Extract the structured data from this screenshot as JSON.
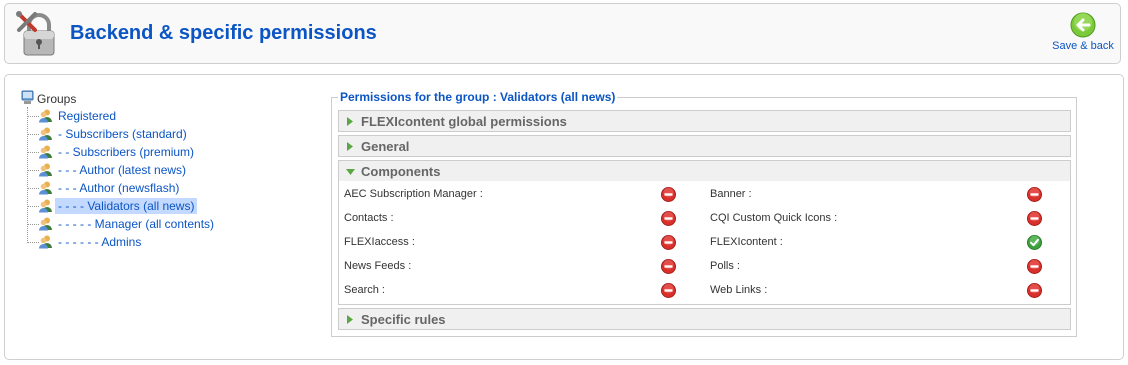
{
  "header": {
    "title": "Backend & specific permissions",
    "save_label": "Save & back"
  },
  "tree": {
    "root_label": "Groups",
    "items": [
      {
        "label": "Registered",
        "selected": false
      },
      {
        "label": "- Subscribers (standard)",
        "selected": false
      },
      {
        "label": "- - Subscribers (premium)",
        "selected": false
      },
      {
        "label": "- - - Author (latest news)",
        "selected": false
      },
      {
        "label": "- - - Author (newsflash)",
        "selected": false
      },
      {
        "label": "- - - - Validators (all news)",
        "selected": true
      },
      {
        "label": "- - - - - Manager (all contents)",
        "selected": false
      },
      {
        "label": "- - - - - - Admins",
        "selected": false
      }
    ]
  },
  "permissions": {
    "legend": "Permissions for the group : Validators (all news)",
    "panels": {
      "global": "FLEXIcontent global permissions",
      "general": "General",
      "components": "Components",
      "specific": "Specific rules"
    },
    "components": [
      {
        "label": "AEC Subscription Manager :",
        "status": "denied"
      },
      {
        "label": "Banner :",
        "status": "denied"
      },
      {
        "label": "Contacts :",
        "status": "denied"
      },
      {
        "label": "CQI Custom Quick Icons :",
        "status": "denied"
      },
      {
        "label": "FLEXIaccess :",
        "status": "denied"
      },
      {
        "label": "FLEXIcontent :",
        "status": "allowed"
      },
      {
        "label": "News Feeds :",
        "status": "denied"
      },
      {
        "label": "Polls :",
        "status": "denied"
      },
      {
        "label": "Search :",
        "status": "denied"
      },
      {
        "label": "Web Links :",
        "status": "denied"
      }
    ]
  },
  "colors": {
    "link": "#0b55c4",
    "denied": "#d9302c",
    "allowed": "#3da13d",
    "selected_bg": "#c3d9ff"
  }
}
